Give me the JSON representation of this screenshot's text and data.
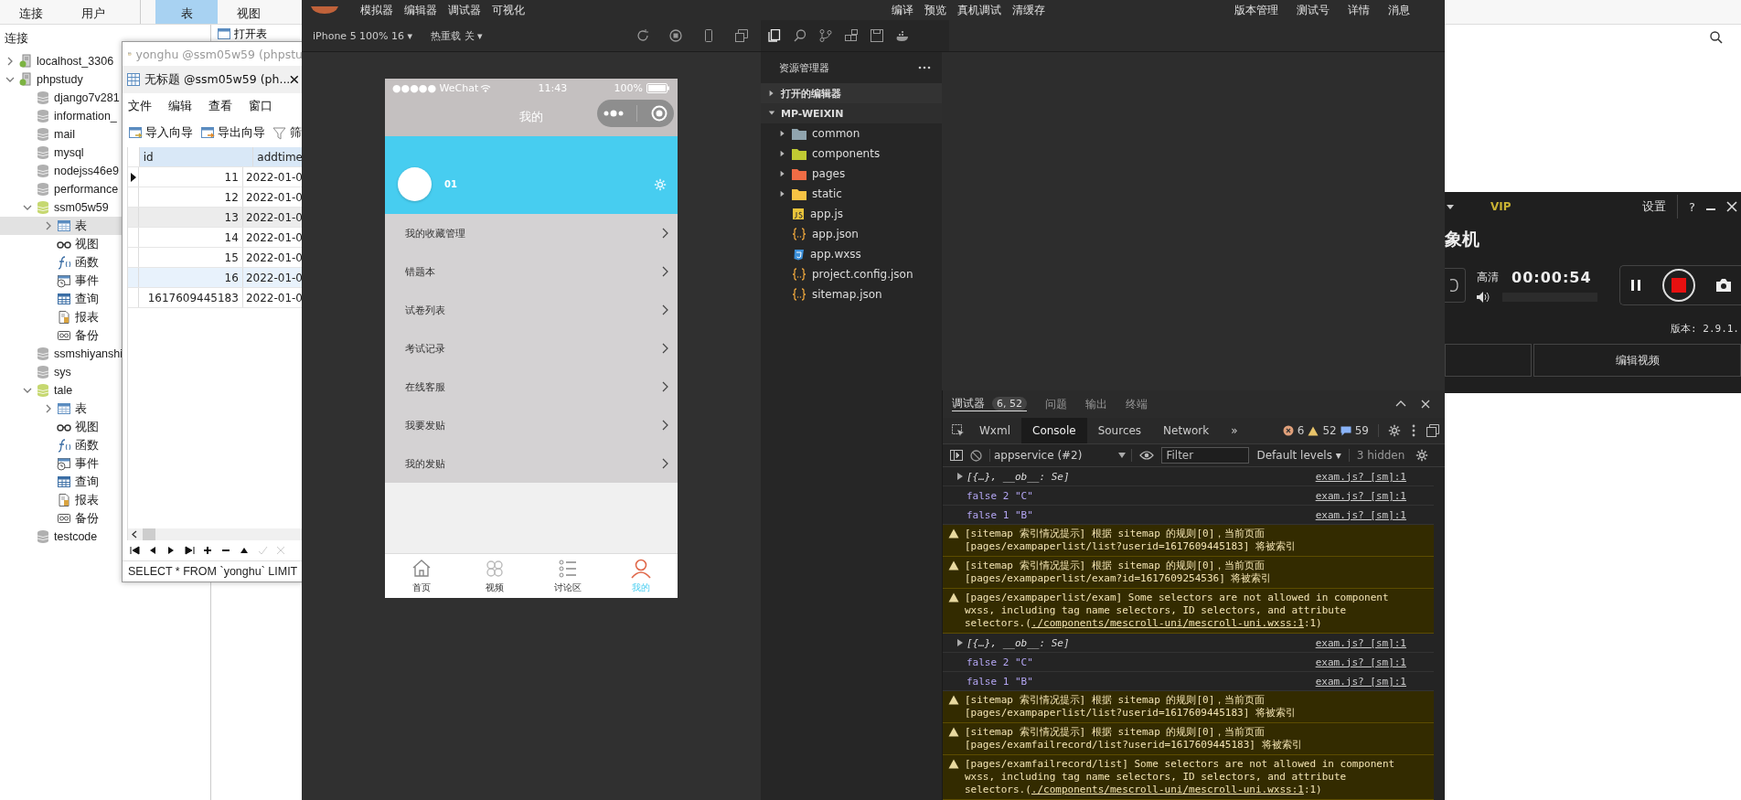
{
  "navicat": {
    "toolbar": [
      {
        "label": "连接",
        "selected": false
      },
      {
        "label": "用户",
        "selected": false
      },
      {
        "label": "表",
        "selected": true
      },
      {
        "label": "视图",
        "selected": false
      }
    ],
    "pane_title": "连接",
    "open_table": "打开表",
    "tree": [
      {
        "label": "localhost_3306",
        "kind": "server",
        "expanded": false,
        "selected": false
      },
      {
        "label": "phpstudy",
        "kind": "server",
        "expanded": true,
        "selected": false,
        "children": [
          {
            "label": "django7v281",
            "kind": "database",
            "selected": false
          },
          {
            "label": "information_",
            "kind": "database",
            "selected": false
          },
          {
            "label": "mail",
            "kind": "database",
            "selected": false
          },
          {
            "label": "mysql",
            "kind": "database",
            "selected": false
          },
          {
            "label": "nodejss46e9",
            "kind": "database",
            "selected": false
          },
          {
            "label": "performance",
            "kind": "database",
            "selected": false
          },
          {
            "label": "ssm05w59",
            "kind": "database",
            "expanded": true,
            "selected": false,
            "children": [
              {
                "label": "表",
                "kind": "table",
                "expanded": false,
                "selected": true
              },
              {
                "label": "视图",
                "kind": "view",
                "selected": false
              },
              {
                "label": "函数",
                "kind": "function",
                "selected": false
              },
              {
                "label": "事件",
                "kind": "event",
                "selected": false
              },
              {
                "label": "查询",
                "kind": "query",
                "selected": false
              },
              {
                "label": "报表",
                "kind": "report",
                "selected": false
              },
              {
                "label": "备份",
                "kind": "backup",
                "selected": false
              }
            ]
          },
          {
            "label": "ssmshiyanshi",
            "kind": "database",
            "selected": false
          },
          {
            "label": "sys",
            "kind": "database",
            "selected": false
          },
          {
            "label": "tale",
            "kind": "database",
            "expanded": true,
            "selected": false,
            "children": [
              {
                "label": "表",
                "kind": "table",
                "expanded": false,
                "selected": false
              },
              {
                "label": "视图",
                "kind": "view",
                "selected": false
              },
              {
                "label": "函数",
                "kind": "function",
                "selected": false
              },
              {
                "label": "事件",
                "kind": "event",
                "selected": false
              },
              {
                "label": "查询",
                "kind": "query",
                "selected": false
              },
              {
                "label": "报表",
                "kind": "report",
                "selected": false
              },
              {
                "label": "备份",
                "kind": "backup",
                "selected": false
              }
            ]
          },
          {
            "label": "testcode",
            "kind": "database",
            "selected": false
          }
        ]
      }
    ]
  },
  "query_window": {
    "back_title": "yonghu @ssm05w59 (phpstu",
    "tab_title": "无标题 @ssm05w59 (ph...",
    "menu": [
      "文件",
      "编辑",
      "查看",
      "窗口"
    ],
    "toolbar": [
      "导入向导",
      "导出向导",
      "筛"
    ],
    "columns": [
      "id",
      "addtime"
    ],
    "rows": [
      {
        "cells": [
          "11",
          "2022-01-0"
        ],
        "current": true,
        "selected": false
      },
      {
        "cells": [
          "12",
          "2022-01-0"
        ],
        "current": false,
        "selected": false
      },
      {
        "cells": [
          "13",
          "2022-01-0"
        ],
        "current": false,
        "selected": false,
        "hovered": true
      },
      {
        "cells": [
          "14",
          "2022-01-0"
        ],
        "current": false,
        "selected": false
      },
      {
        "cells": [
          "15",
          "2022-01-0"
        ],
        "current": false,
        "selected": false
      },
      {
        "cells": [
          "16",
          "2022-01-0"
        ],
        "current": false,
        "selected": true
      },
      {
        "cells": [
          "1617609445183",
          "2022-01-0"
        ],
        "current": false,
        "selected": false
      }
    ],
    "sql": "SELECT * FROM `yonghu` LIMIT"
  },
  "devtools": {
    "menu_left": [
      "模拟器",
      "编辑器",
      "调试器",
      "可视化"
    ],
    "menu_center": [
      "编译",
      "预览",
      "真机调试",
      "清缓存"
    ],
    "menu_right": [
      "版本管理",
      "测试号",
      "详情",
      "消息"
    ],
    "device": "iPhone 5 100% 16 ▾",
    "hot_reload": "热重载 关 ▾",
    "phone": {
      "carrier": "●●●●● WeChat",
      "time": "11:43",
      "battery": "100%",
      "title": "我的",
      "user": "01",
      "menu": [
        "我的收藏管理",
        "错题本",
        "试卷列表",
        "考试记录",
        "在线客服",
        "我要发贴",
        "我的发贴"
      ],
      "tabs": [
        {
          "label": "首页",
          "kind": "home",
          "selected": false
        },
        {
          "label": "视频",
          "kind": "grid",
          "selected": false
        },
        {
          "label": "讨论区",
          "kind": "list",
          "selected": false
        },
        {
          "label": "我的",
          "kind": "person",
          "selected": true
        }
      ]
    },
    "explorer": {
      "title": "资源管理器",
      "sections": [
        {
          "label": "打开的编辑器",
          "expanded": false
        },
        {
          "label": "MP-WEIXIN",
          "expanded": true
        }
      ],
      "files": [
        {
          "name": "common",
          "kind": "folder",
          "color": "#90a4ae",
          "expanded": false
        },
        {
          "name": "components",
          "kind": "folder",
          "color": "#c0ca33",
          "expanded": false
        },
        {
          "name": "pages",
          "kind": "folder",
          "color": "#ef6c45",
          "expanded": false
        },
        {
          "name": "static",
          "kind": "folder",
          "color": "#f6c344",
          "expanded": false
        },
        {
          "name": "app.js",
          "kind": "js"
        },
        {
          "name": "app.json",
          "kind": "json"
        },
        {
          "name": "app.wxss",
          "kind": "wxss"
        },
        {
          "name": "project.config.json",
          "kind": "json"
        },
        {
          "name": "sitemap.json",
          "kind": "json"
        }
      ]
    },
    "debugger": {
      "tabs": [
        {
          "label": "调试器",
          "selected": true,
          "badge": "6, 52"
        },
        {
          "label": "问题",
          "selected": false
        },
        {
          "label": "输出",
          "selected": false
        },
        {
          "label": "终端",
          "selected": false
        }
      ],
      "panel_tabs": [
        {
          "label": "Wxml",
          "selected": false
        },
        {
          "label": "Console",
          "selected": true
        },
        {
          "label": "Sources",
          "selected": false
        },
        {
          "label": "Network",
          "selected": false
        }
      ],
      "more": "»",
      "errors": "6",
      "warnings": "52",
      "infos": "59",
      "context": "appservice (#2)",
      "filter_placeholder": "Filter",
      "levels": "Default levels ▾",
      "hidden": "3 hidden",
      "messages": [
        {
          "kind": "object",
          "text": "[{…}, __ob__: Se]",
          "source": "exam.js? [sm]:1"
        },
        {
          "kind": "log",
          "text": "false 2 \"C\"",
          "source": "exam.js? [sm]:1"
        },
        {
          "kind": "log",
          "text": "false 1 \"B\"",
          "source": "exam.js? [sm]:1"
        },
        {
          "kind": "warning",
          "text": "[sitemap 索引情况提示] 根据 sitemap 的规则[0]，当前页面 [pages/exampaperlist/list?userid=1617609445183] 将被索引"
        },
        {
          "kind": "warning",
          "text": "[sitemap 索引情况提示] 根据 sitemap 的规则[0]，当前页面 [pages/exampaperlist/exam?id=1617609254536] 将被索引"
        },
        {
          "kind": "warning",
          "text": "[pages/exampaperlist/exam] Some selectors are not allowed in component wxss, including tag name selectors, ID selectors, and attribute selectors.(",
          "link": "./components/mescroll-uni/mescroll-uni.wxss:1",
          "after": ":1)"
        },
        {
          "kind": "object",
          "text": "[{…}, __ob__: Se]",
          "source": "exam.js? [sm]:1"
        },
        {
          "kind": "log",
          "text": "false 2 \"C\"",
          "source": "exam.js? [sm]:1"
        },
        {
          "kind": "log",
          "text": "false 1 \"B\"",
          "source": "exam.js? [sm]:1"
        },
        {
          "kind": "warning",
          "text": "[sitemap 索引情况提示] 根据 sitemap 的规则[0]，当前页面 [pages/exampaperlist/list?userid=1617609445183] 将被索引"
        },
        {
          "kind": "warning",
          "text": "[sitemap 索引情况提示] 根据 sitemap 的规则[0]，当前页面 [pages/examfailrecord/list?userid=1617609445183] 将被索引"
        },
        {
          "kind": "warning",
          "text": "[pages/examfailrecord/list] Some selectors are not allowed in component wxss, including tag name selectors, ID selectors, and attribute selectors.(",
          "link": "./components/mescroll-uni/mescroll-uni.wxss:1",
          "after": ":1)"
        }
      ]
    }
  },
  "recorder": {
    "vip": "VIP",
    "settings": "设置",
    "help": "?",
    "title": "象机",
    "quality": "高清",
    "timer": "00:00:54",
    "version": "版本: 2.9.1.",
    "edit_button": "编辑视频"
  }
}
